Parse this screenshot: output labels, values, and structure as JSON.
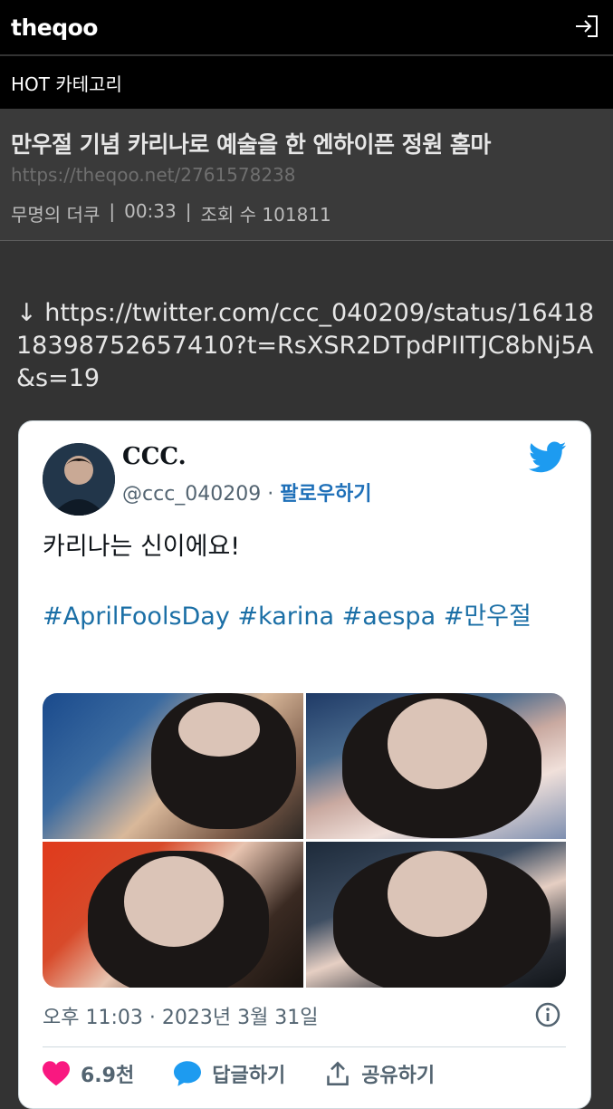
{
  "header": {
    "logo": "theqoo"
  },
  "category": {
    "label": "HOT 카테고리"
  },
  "post": {
    "title": "만우절 기념 카리나로 예술을 한 엔하이픈 정원 홈마",
    "url": "https://theqoo.net/2761578238",
    "author": "무명의 더쿠",
    "time": "00:33",
    "views": "조회 수 101811",
    "separator": "|"
  },
  "body": {
    "link": "↓ https://twitter.com/ccc_040209/status/1641818398752657410?t=RsXSR2DTpdPIITJC8bNj5A&s=19"
  },
  "tweet": {
    "display_name": "CCC.",
    "handle": "@ccc_040209",
    "dot": "·",
    "follow_label": "팔로우하기",
    "text": "카리나는 신이에요!",
    "hashtags": "#AprilFoolsDay #karina #aespa #만우절",
    "timestamp": "오후 11:03 · 2023년 3월 31일",
    "likes": "6.9천",
    "reply_label": "답글하기",
    "share_label": "공유하기",
    "colors": {
      "like": "#f91880",
      "reply": "#1d9bf0",
      "twitter": "#1d9bf0",
      "link": "#1b6fa6"
    }
  }
}
